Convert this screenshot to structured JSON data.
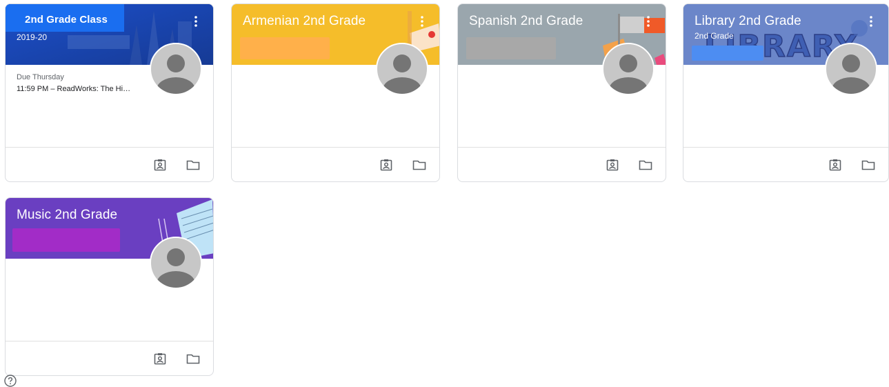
{
  "classes": [
    {
      "title": "2nd Grade Class",
      "subtitle": "2019-20",
      "header_color": "#1e5bd8",
      "due_label": "Due Thursday",
      "due_item": "11:59 PM – ReadWorks: The Hi…",
      "footer_icons": [
        "your-work-icon",
        "folder-icon"
      ]
    },
    {
      "title": "Armenian 2nd Grade",
      "subtitle": "",
      "header_color": "#f5bd2a",
      "redact_color": "#ffb04a",
      "footer_icons": [
        "your-work-icon",
        "folder-icon"
      ]
    },
    {
      "title": "Spanish 2nd Grade",
      "subtitle": "",
      "header_color": "#9aa6ad",
      "redact_color": "#a8a8a8",
      "footer_icons": [
        "your-work-icon",
        "folder-icon"
      ]
    },
    {
      "title": "Library 2nd Grade",
      "subtitle": "2nd Grade",
      "header_color": "#6b86c9",
      "redact_color": "#4d8df2",
      "banner_art_text": "LIBRARY",
      "footer_icons": [
        "your-work-icon",
        "folder-icon"
      ]
    },
    {
      "title": "Music 2nd Grade",
      "subtitle": "",
      "header_color": "#6a3fc1",
      "redact_color": "#a22cc7",
      "footer_icons": [
        "your-work-icon",
        "folder-icon"
      ]
    }
  ],
  "help": {
    "icon": "help-icon"
  }
}
